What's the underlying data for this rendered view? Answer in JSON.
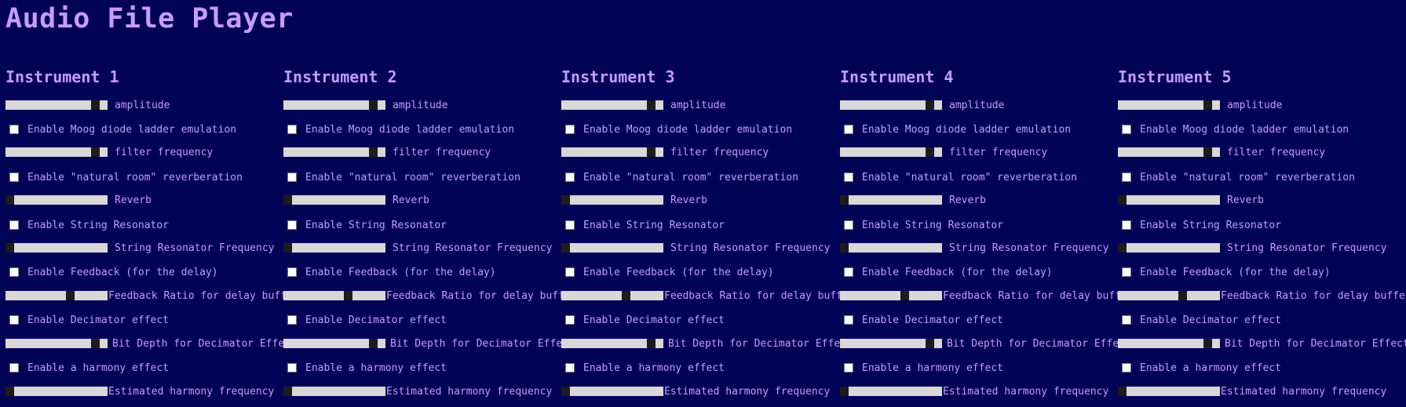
{
  "app": {
    "title": "Audio File Player"
  },
  "colors": {
    "background": "#020356",
    "text": "#c69cff",
    "slider_track": "#d8d8d8",
    "slider_thumb": "#1c1c1c"
  },
  "instruments": [
    {
      "name": "Instrument 1"
    },
    {
      "name": "Instrument 2"
    },
    {
      "name": "Instrument 3"
    },
    {
      "name": "Instrument 4"
    },
    {
      "name": "Instrument 5"
    }
  ],
  "controls": [
    {
      "type": "slider",
      "label": "amplitude",
      "value": 0.92
    },
    {
      "type": "checkbox",
      "label": "Enable Moog diode ladder emulation",
      "checked": false
    },
    {
      "type": "slider",
      "label": "filter frequency",
      "value": 0.92
    },
    {
      "type": "checkbox",
      "label": "Enable \"natural room\" reverberation",
      "checked": false
    },
    {
      "type": "slider",
      "label": "Reverb",
      "value": 0.0
    },
    {
      "type": "checkbox",
      "label": "Enable String Resonator",
      "checked": false
    },
    {
      "type": "slider",
      "label": "String Resonator Frequency",
      "value": 0.0
    },
    {
      "type": "checkbox",
      "label": "Enable Feedback (for the delay)",
      "checked": false
    },
    {
      "type": "slider",
      "label": "Feedback Ratio for delay buffer",
      "value": 0.65
    },
    {
      "type": "checkbox",
      "label": "Enable Decimator effect",
      "checked": false
    },
    {
      "type": "slider",
      "label": "Bit Depth for Decimator Effect",
      "value": 0.92
    },
    {
      "type": "checkbox",
      "label": "Enable a harmony effect",
      "checked": false
    },
    {
      "type": "slider",
      "label": "Estimated harmony frequency",
      "value": 0.0
    }
  ]
}
